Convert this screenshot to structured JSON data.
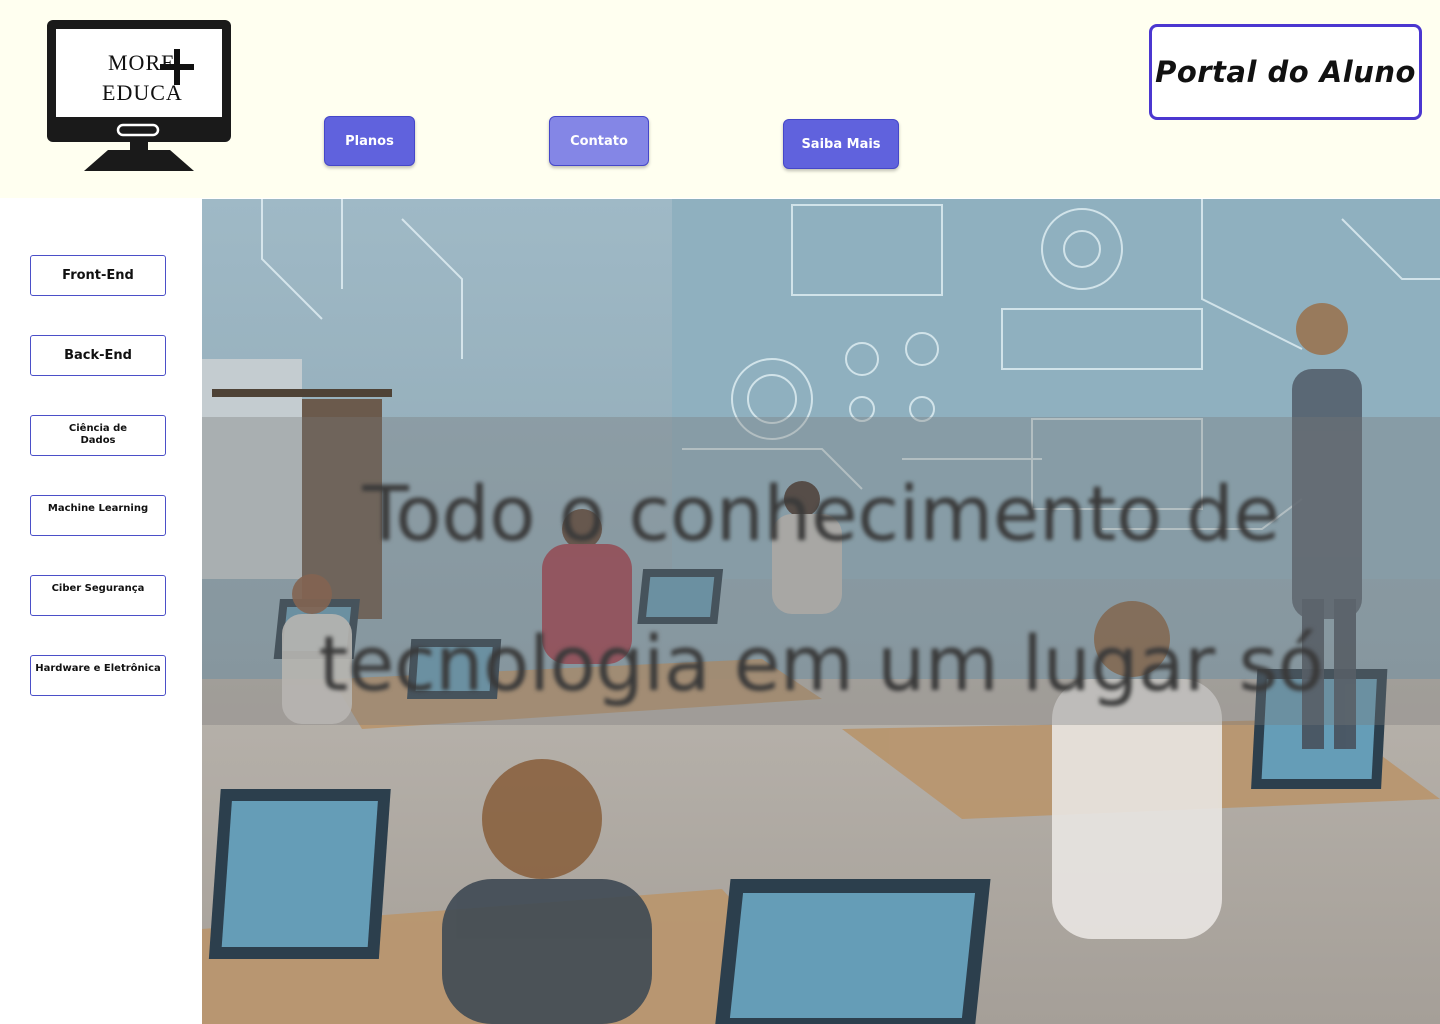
{
  "header": {
    "logo": {
      "line1": "MORE",
      "line2": "EDUCA",
      "icon": "monitor-plus-icon"
    },
    "nav": [
      {
        "label": "Planos"
      },
      {
        "label": "Contato"
      },
      {
        "label": "Saiba Mais"
      }
    ],
    "portal_label": "Portal do Aluno"
  },
  "sidebar": {
    "items": [
      {
        "label": "Front-End"
      },
      {
        "label": "Back-End"
      },
      {
        "label": "Ciência de Dados"
      },
      {
        "label": "Machine Learning"
      },
      {
        "label": "Ciber Segurança"
      },
      {
        "label": "Hardware e Eletrônica"
      }
    ]
  },
  "hero": {
    "line1": "Todo o conhecimento de",
    "line2": "tecnologia em um lugar só",
    "image": "classroom-technology-photo"
  },
  "colors": {
    "header_bg": "#fffff0",
    "nav_button": "#6062dd",
    "nav_button_light": "#8486e6",
    "portal_border": "#4b37d0",
    "sidebar_border": "#4b4fc8"
  }
}
